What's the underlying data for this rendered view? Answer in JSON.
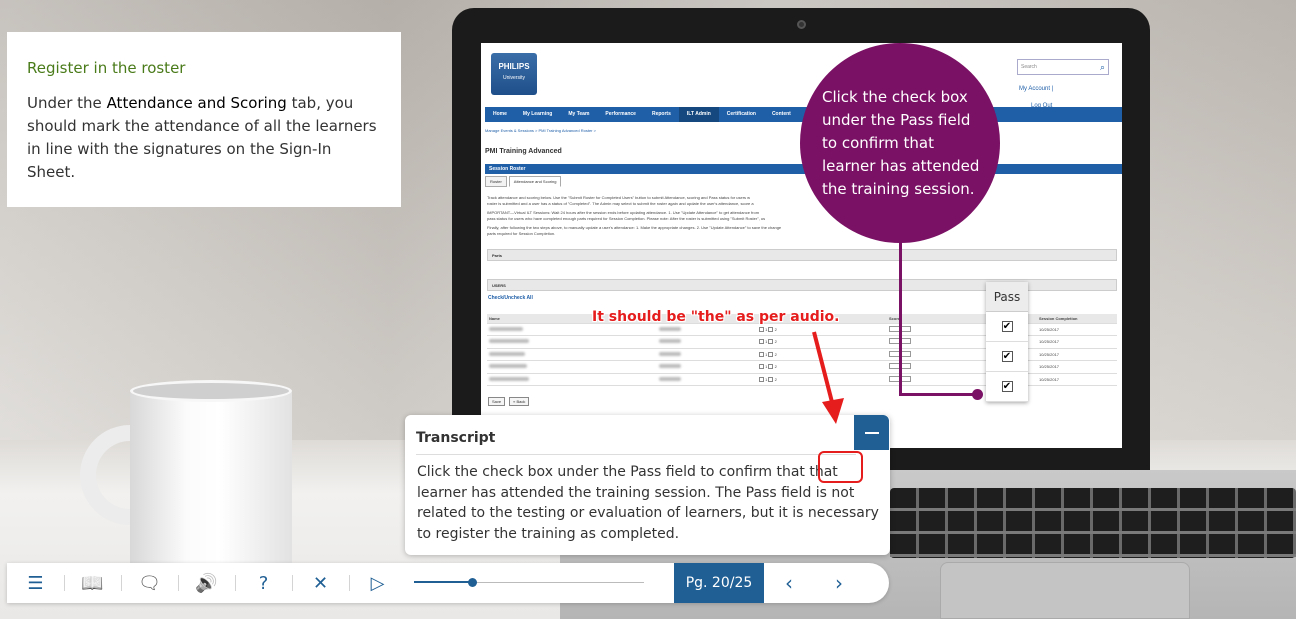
{
  "info_card": {
    "title": "Register in the roster",
    "body_prefix": "Under the ",
    "body_bold": "Attendance and Scoring",
    "body_suffix": " tab, you should mark the attendance of all the learners in line with the signatures on the Sign-In Sheet."
  },
  "callout_bubble": {
    "text": "Click the check box under the Pass field to confirm that learner has attended the training session."
  },
  "annotation": {
    "text": "It should be \"the\" as per audio.",
    "color": "#e61d1d"
  },
  "pass_zoom": {
    "header": "Pass",
    "checks": [
      "✔",
      "✔",
      "✔"
    ]
  },
  "screen": {
    "logo": {
      "brand": "PHILIPS",
      "sub": "University"
    },
    "search_placeholder": "Search",
    "links": [
      "My Account |",
      "Log Out"
    ],
    "nav": [
      "Home",
      "My Learning",
      "My Team",
      "Performance",
      "Reports",
      "ILT Admin",
      "Certification",
      "Content",
      "Admin"
    ],
    "active_nav": "ILT Admin",
    "breadcrumb": "Manage Events & Sessions  >  PMI Training Advanced Roster  >",
    "heading": "PMI Training Advanced",
    "section_bar": "Session Roster",
    "tabs": [
      "Roster",
      "Attendance and Scoring"
    ],
    "instructions": [
      "Track attendance and scoring below. Use the \"Submit Roster for Completed Users\" button to submit Attendance, scoring and Pass status for users w",
      "roster is submitted and a user has a status of \"Completed\". The Admin may select to submit the roster again and update the user's attendance, score a",
      "IMPORTANT—Virtual ILT Sessions: Wait 24 hours after the session ends before updating attendance. 1. Use \"Update Attendance\" to get attendance from",
      "pass status for users who have completed enough parts required for Session Completion. Please note: After the roster is submitted using \"Submit Roster\", us",
      "Finally, after following the two steps above, to manually update a user's attendance: 1. Make the appropriate changes. 2. Use \"Update Attendance\" to save the change",
      "parts required for Session Completion."
    ],
    "parts_label": "Parts",
    "users_label": "USERS",
    "check_all": "Check/Uncheck All",
    "columns": {
      "name": "Name",
      "score": "Score",
      "completion": "Session Completion"
    },
    "rows": [
      {
        "completion": "10/25/2017"
      },
      {
        "completion": "10/25/2017"
      },
      {
        "completion": "10/25/2017"
      },
      {
        "completion": "10/25/2017"
      },
      {
        "completion": "10/25/2017"
      }
    ],
    "attendance_labels": [
      "1",
      "2"
    ],
    "buttons": [
      "Save",
      "« Back"
    ]
  },
  "transcript": {
    "title": "Transcript",
    "text": "Click the check box under the Pass field to confirm that that learner has attended the training session. The Pass field is not related to the testing or evaluation of learners, but it is necessary to register the training as completed."
  },
  "player": {
    "buttons": [
      {
        "name": "menu-button",
        "icon": "menu-icon",
        "glyph": "☰"
      },
      {
        "name": "glossary-button",
        "icon": "book-icon",
        "glyph": "📖"
      },
      {
        "name": "transcript-button",
        "icon": "chat-icon",
        "glyph": "🗨"
      },
      {
        "name": "volume-button",
        "icon": "speaker-icon",
        "glyph": "🔊"
      },
      {
        "name": "help-button",
        "icon": "help-icon",
        "glyph": "?"
      },
      {
        "name": "close-button",
        "icon": "close-icon",
        "glyph": "✕"
      },
      {
        "name": "play-button",
        "icon": "play-icon",
        "glyph": "▷"
      }
    ],
    "progress": 0.25,
    "page_label": "Pg. 20/25",
    "prev_glyph": "‹",
    "next_glyph": "›"
  },
  "colors": {
    "brand_blue": "#1f5f94",
    "bubble_purple": "#7a1164",
    "title_green": "#4a7b1a"
  }
}
